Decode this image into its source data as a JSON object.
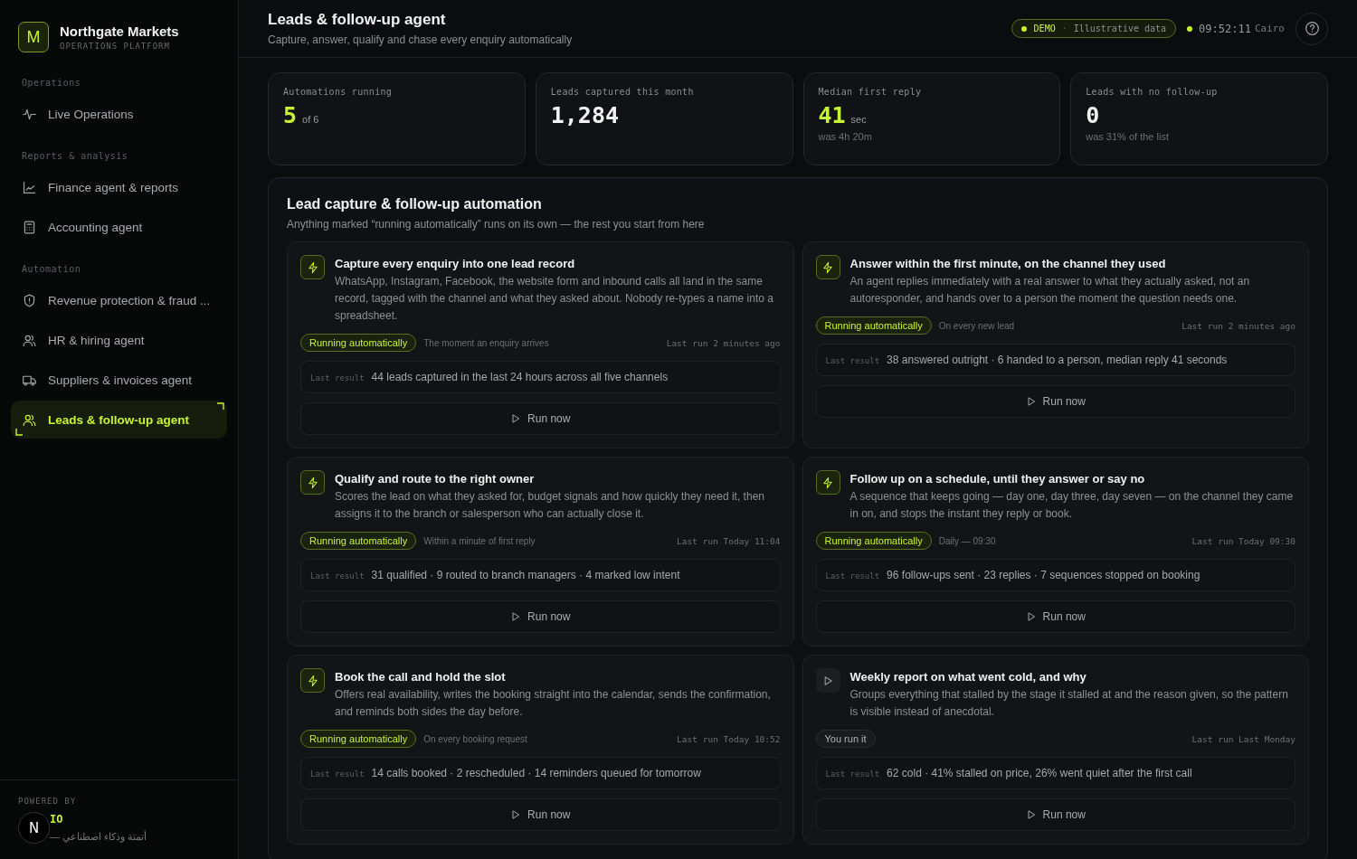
{
  "brand": {
    "logo_letter": "M",
    "name": "Northgate Markets",
    "subtitle": "OPERATIONS PLATFORM"
  },
  "nav": [
    {
      "heading": "Operations",
      "items": [
        {
          "label": "Live Operations",
          "kind": "pulse",
          "selected": false
        }
      ]
    },
    {
      "heading": "Reports & analysis",
      "items": [
        {
          "label": "Finance agent & reports",
          "kind": "chart",
          "selected": false
        },
        {
          "label": "Accounting agent",
          "kind": "calculator",
          "selected": false
        }
      ]
    },
    {
      "heading": "Automation",
      "items": [
        {
          "label": "Revenue protection & fraud ...",
          "kind": "shield",
          "selected": false
        },
        {
          "label": "HR & hiring agent",
          "kind": "people",
          "selected": false
        },
        {
          "label": "Suppliers & invoices agent",
          "kind": "truck",
          "selected": false
        },
        {
          "label": "Leads & follow-up agent",
          "kind": "people",
          "selected": true
        }
      ]
    }
  ],
  "footer": {
    "powered_by": "POWERED BY",
    "brand": "IO",
    "tagline": "أتمتة وذكاء اصطناعي —",
    "overlay_letter": "N"
  },
  "header": {
    "title": "Leads & follow-up agent",
    "subtitle": "Capture, answer, qualify and chase every enquiry automatically",
    "demo_tag": "DEMO",
    "demo_separator": "·",
    "demo_text": "Illustrative data",
    "time": "09:52:11",
    "city": "Cairo"
  },
  "stats": [
    {
      "label": "Automations running",
      "value": "5",
      "unit": "of 6",
      "highlight": true
    },
    {
      "label": "Leads captured this month",
      "value": "1,284",
      "highlight": false
    },
    {
      "label": "Median first reply",
      "value": "41",
      "unit": "sec",
      "note": "was 4h 20m",
      "highlight": true
    },
    {
      "label": "Leads with no follow-up",
      "value": "0",
      "note": "was 31% of the list",
      "highlight": false
    }
  ],
  "panel": {
    "title": "Lead capture & follow-up automation",
    "subtitle": "Anything marked “running automatically” runs on its own — the rest you start from here",
    "automations": [
      {
        "title": "Capture every enquiry into one lead record",
        "description": "WhatsApp, Instagram, Facebook, the website form and inbound calls all land in the same record, tagged with the channel and what they asked about. Nobody re-types a name into a spreadsheet.",
        "running": true,
        "status": "Running automatically",
        "trigger": "The moment an enquiry arrives",
        "last_run": "Last run 2 minutes ago",
        "result_label": "Last result",
        "result": "44 leads captured in the last 24 hours across all five channels",
        "button": "Run now"
      },
      {
        "title": "Answer within the first minute, on the channel they used",
        "description": "An agent replies immediately with a real answer to what they actually asked, not an autoresponder, and hands over to a person the moment the question needs one.",
        "running": true,
        "status": "Running automatically",
        "trigger": "On every new lead",
        "last_run": "Last run 2 minutes ago",
        "result_label": "Last result",
        "result": "38 answered outright · 6 handed to a person, median reply 41 seconds",
        "button": "Run now"
      },
      {
        "title": "Qualify and route to the right owner",
        "description": "Scores the lead on what they asked for, budget signals and how quickly they need it, then assigns it to the branch or salesperson who can actually close it.",
        "running": true,
        "status": "Running automatically",
        "trigger": "Within a minute of first reply",
        "last_run": "Last run Today 11:04",
        "result_label": "Last result",
        "result": "31 qualified · 9 routed to branch managers · 4 marked low intent",
        "button": "Run now"
      },
      {
        "title": "Follow up on a schedule, until they answer or say no",
        "description": "A sequence that keeps going — day one, day three, day seven — on the channel they came in on, and stops the instant they reply or book.",
        "running": true,
        "status": "Running automatically",
        "trigger": "Daily — 09:30",
        "last_run": "Last run Today 09:30",
        "result_label": "Last result",
        "result": "96 follow-ups sent · 23 replies · 7 sequences stopped on booking",
        "button": "Run now"
      },
      {
        "title": "Book the call and hold the slot",
        "description": "Offers real availability, writes the booking straight into the calendar, sends the confirmation, and reminds both sides the day before.",
        "running": true,
        "status": "Running automatically",
        "trigger": "On every booking request",
        "last_run": "Last run Today 10:52",
        "result_label": "Last result",
        "result": "14 calls booked · 2 rescheduled · 14 reminders queued for tomorrow",
        "button": "Run now"
      },
      {
        "title": "Weekly report on what went cold, and why",
        "description": "Groups everything that stalled by the stage it stalled at and the reason given, so the pattern is visible instead of anecdotal.",
        "running": false,
        "status": "You run it",
        "last_run": "Last run Last Monday",
        "result_label": "Last result",
        "result": "62 cold · 41% stalled on price, 26% went quiet after the first call",
        "button": "Run now"
      }
    ]
  }
}
